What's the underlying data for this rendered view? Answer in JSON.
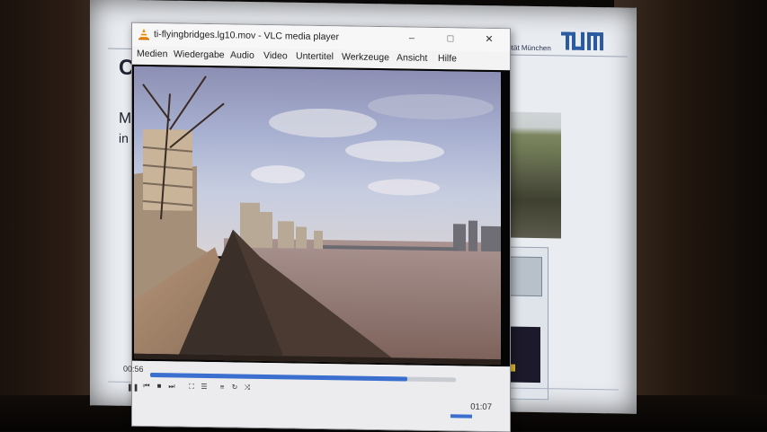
{
  "slide": {
    "university_text": "sität München",
    "logo_text": "TUM",
    "heading_fragment": "C",
    "line1_fragment": "M",
    "line2_fragment": "in"
  },
  "vlc": {
    "title": "ti-flyingbridges.lg10.mov - VLC media player",
    "window_buttons": {
      "minimize": "–",
      "maximize": "□",
      "close": "✕"
    },
    "menu": [
      "Medien",
      "Wiedergabe",
      "Audio",
      "Video",
      "Untertitel",
      "Werkzeuge",
      "Ansicht",
      "Hilfe"
    ],
    "playback": {
      "elapsed": "00:56",
      "total": "01:07",
      "progress": 0.84,
      "volume": 0.6
    },
    "controls": {
      "play_pause_icon": "pause-icon",
      "prev_icon": "prev-icon",
      "stop_icon": "stop-icon",
      "next_icon": "next-icon",
      "fullscreen_icon": "fullscreen-icon",
      "extended_icon": "extended-settings-icon",
      "playlist_icon": "playlist-icon",
      "loop_icon": "loop-icon",
      "shuffle_icon": "shuffle-icon",
      "volume_icon": "volume-icon"
    }
  },
  "colors": {
    "accent": "#3a6fd0",
    "vlc_cone": "#f08a00",
    "tum_blue": "#2c5aa0"
  }
}
